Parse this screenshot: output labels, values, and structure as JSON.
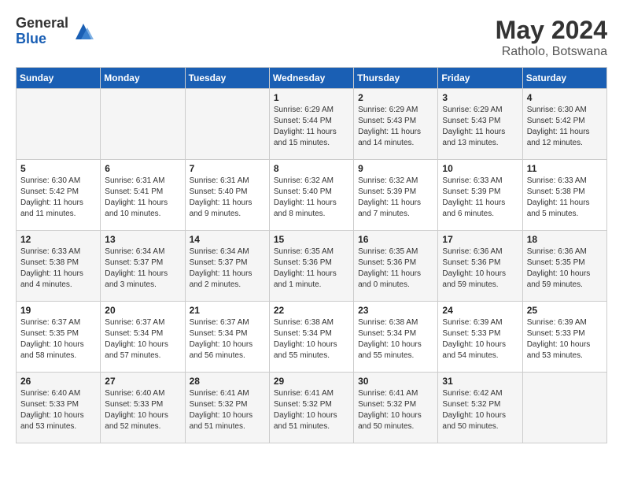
{
  "header": {
    "logo_general": "General",
    "logo_blue": "Blue",
    "month_year": "May 2024",
    "location": "Ratholo, Botswana"
  },
  "weekdays": [
    "Sunday",
    "Monday",
    "Tuesday",
    "Wednesday",
    "Thursday",
    "Friday",
    "Saturday"
  ],
  "weeks": [
    [
      {
        "day": "",
        "info": ""
      },
      {
        "day": "",
        "info": ""
      },
      {
        "day": "",
        "info": ""
      },
      {
        "day": "1",
        "info": "Sunrise: 6:29 AM\nSunset: 5:44 PM\nDaylight: 11 hours\nand 15 minutes."
      },
      {
        "day": "2",
        "info": "Sunrise: 6:29 AM\nSunset: 5:43 PM\nDaylight: 11 hours\nand 14 minutes."
      },
      {
        "day": "3",
        "info": "Sunrise: 6:29 AM\nSunset: 5:43 PM\nDaylight: 11 hours\nand 13 minutes."
      },
      {
        "day": "4",
        "info": "Sunrise: 6:30 AM\nSunset: 5:42 PM\nDaylight: 11 hours\nand 12 minutes."
      }
    ],
    [
      {
        "day": "5",
        "info": "Sunrise: 6:30 AM\nSunset: 5:42 PM\nDaylight: 11 hours\nand 11 minutes."
      },
      {
        "day": "6",
        "info": "Sunrise: 6:31 AM\nSunset: 5:41 PM\nDaylight: 11 hours\nand 10 minutes."
      },
      {
        "day": "7",
        "info": "Sunrise: 6:31 AM\nSunset: 5:40 PM\nDaylight: 11 hours\nand 9 minutes."
      },
      {
        "day": "8",
        "info": "Sunrise: 6:32 AM\nSunset: 5:40 PM\nDaylight: 11 hours\nand 8 minutes."
      },
      {
        "day": "9",
        "info": "Sunrise: 6:32 AM\nSunset: 5:39 PM\nDaylight: 11 hours\nand 7 minutes."
      },
      {
        "day": "10",
        "info": "Sunrise: 6:33 AM\nSunset: 5:39 PM\nDaylight: 11 hours\nand 6 minutes."
      },
      {
        "day": "11",
        "info": "Sunrise: 6:33 AM\nSunset: 5:38 PM\nDaylight: 11 hours\nand 5 minutes."
      }
    ],
    [
      {
        "day": "12",
        "info": "Sunrise: 6:33 AM\nSunset: 5:38 PM\nDaylight: 11 hours\nand 4 minutes."
      },
      {
        "day": "13",
        "info": "Sunrise: 6:34 AM\nSunset: 5:37 PM\nDaylight: 11 hours\nand 3 minutes."
      },
      {
        "day": "14",
        "info": "Sunrise: 6:34 AM\nSunset: 5:37 PM\nDaylight: 11 hours\nand 2 minutes."
      },
      {
        "day": "15",
        "info": "Sunrise: 6:35 AM\nSunset: 5:36 PM\nDaylight: 11 hours\nand 1 minute."
      },
      {
        "day": "16",
        "info": "Sunrise: 6:35 AM\nSunset: 5:36 PM\nDaylight: 11 hours\nand 0 minutes."
      },
      {
        "day": "17",
        "info": "Sunrise: 6:36 AM\nSunset: 5:36 PM\nDaylight: 10 hours\nand 59 minutes."
      },
      {
        "day": "18",
        "info": "Sunrise: 6:36 AM\nSunset: 5:35 PM\nDaylight: 10 hours\nand 59 minutes."
      }
    ],
    [
      {
        "day": "19",
        "info": "Sunrise: 6:37 AM\nSunset: 5:35 PM\nDaylight: 10 hours\nand 58 minutes."
      },
      {
        "day": "20",
        "info": "Sunrise: 6:37 AM\nSunset: 5:34 PM\nDaylight: 10 hours\nand 57 minutes."
      },
      {
        "day": "21",
        "info": "Sunrise: 6:37 AM\nSunset: 5:34 PM\nDaylight: 10 hours\nand 56 minutes."
      },
      {
        "day": "22",
        "info": "Sunrise: 6:38 AM\nSunset: 5:34 PM\nDaylight: 10 hours\nand 55 minutes."
      },
      {
        "day": "23",
        "info": "Sunrise: 6:38 AM\nSunset: 5:34 PM\nDaylight: 10 hours\nand 55 minutes."
      },
      {
        "day": "24",
        "info": "Sunrise: 6:39 AM\nSunset: 5:33 PM\nDaylight: 10 hours\nand 54 minutes."
      },
      {
        "day": "25",
        "info": "Sunrise: 6:39 AM\nSunset: 5:33 PM\nDaylight: 10 hours\nand 53 minutes."
      }
    ],
    [
      {
        "day": "26",
        "info": "Sunrise: 6:40 AM\nSunset: 5:33 PM\nDaylight: 10 hours\nand 53 minutes."
      },
      {
        "day": "27",
        "info": "Sunrise: 6:40 AM\nSunset: 5:33 PM\nDaylight: 10 hours\nand 52 minutes."
      },
      {
        "day": "28",
        "info": "Sunrise: 6:41 AM\nSunset: 5:32 PM\nDaylight: 10 hours\nand 51 minutes."
      },
      {
        "day": "29",
        "info": "Sunrise: 6:41 AM\nSunset: 5:32 PM\nDaylight: 10 hours\nand 51 minutes."
      },
      {
        "day": "30",
        "info": "Sunrise: 6:41 AM\nSunset: 5:32 PM\nDaylight: 10 hours\nand 50 minutes."
      },
      {
        "day": "31",
        "info": "Sunrise: 6:42 AM\nSunset: 5:32 PM\nDaylight: 10 hours\nand 50 minutes."
      },
      {
        "day": "",
        "info": ""
      }
    ]
  ]
}
